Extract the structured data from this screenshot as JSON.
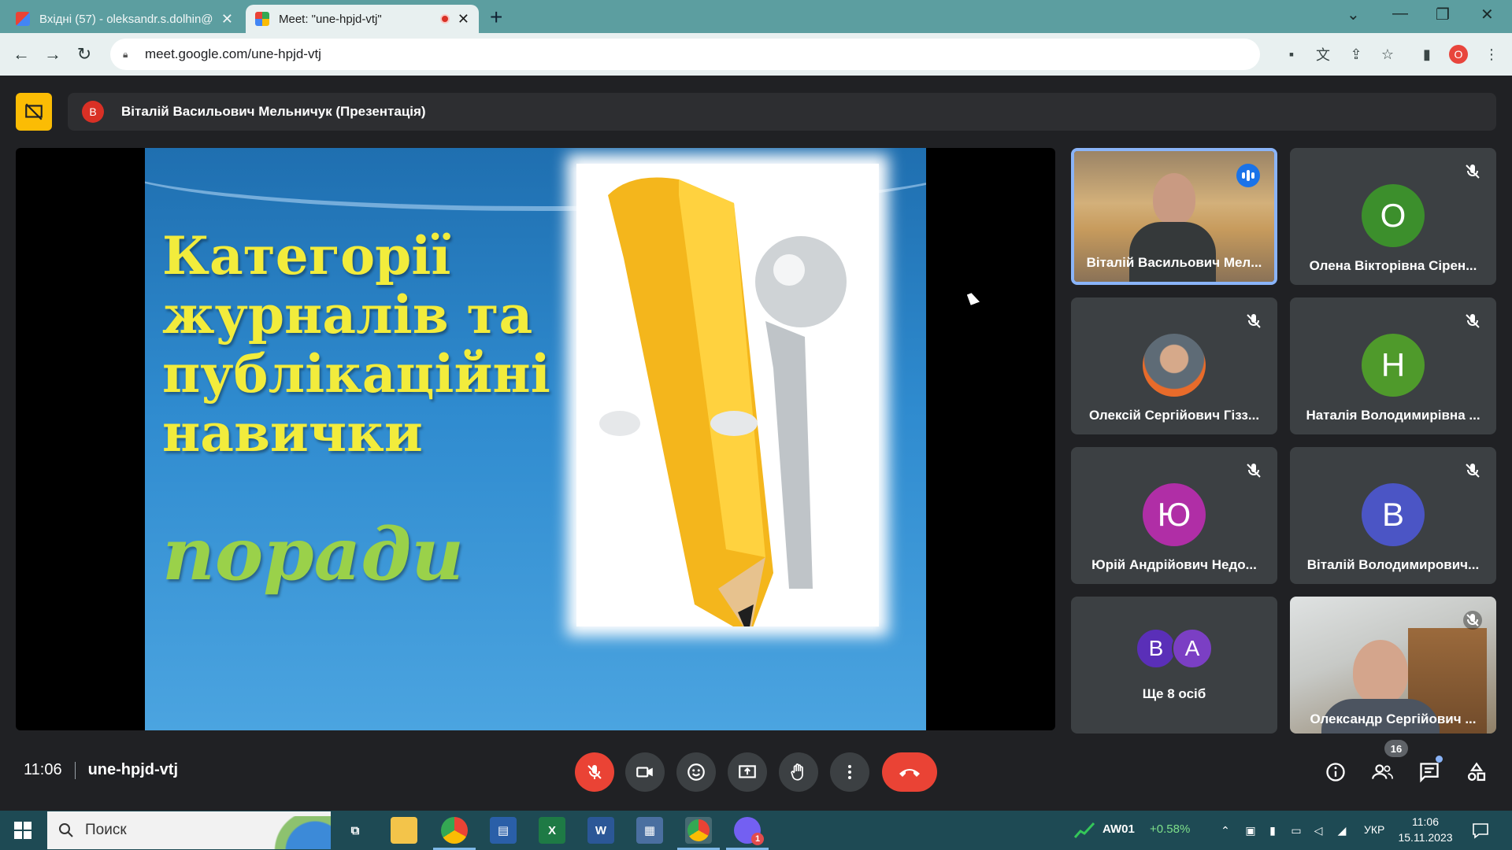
{
  "browser": {
    "tabs": [
      {
        "title": "Вхідні (57) - oleksandr.s.dolhin@",
        "favicon": "gmail-icon",
        "active": false
      },
      {
        "title": "Meet: \"une-hpjd-vtj\"",
        "favicon": "meet-icon",
        "active": true,
        "recording": true
      }
    ],
    "url": "meet.google.com/une-hpjd-vtj",
    "profile_initial": "O"
  },
  "presenting": {
    "avatar_initial": "В",
    "label": "Віталій Васильович Мельничук (Презентація)"
  },
  "slide": {
    "title_lines": [
      "Категорії",
      "журналів та",
      "публікаційні",
      "навички"
    ],
    "subtitle": "поради"
  },
  "participants": [
    {
      "name": "Віталій Васильович Мел...",
      "type": "video",
      "speaking": true
    },
    {
      "name": "Олена Вікторівна Сірен...",
      "initial": "О",
      "color": "#3c8f2c",
      "muted": true
    },
    {
      "name": "Олексій Сергійович Гізз...",
      "type": "photo",
      "muted": true
    },
    {
      "name": "Наталія Володимирівна ...",
      "initial": "Н",
      "color": "#4f9a2b",
      "muted": true
    },
    {
      "name": "Юрій Андрійович Недо...",
      "initial": "Ю",
      "color": "#b02ea6",
      "muted": true
    },
    {
      "name": "Віталій Володимирович...",
      "initial": "В",
      "color": "#4b55c5",
      "muted": true
    },
    {
      "name": "Ще 8 осіб",
      "type": "more",
      "initials": [
        "В",
        "А"
      ],
      "colors": [
        "#5a2fb8",
        "#7b3fc4"
      ]
    },
    {
      "name": "Олександр Сергійович ...",
      "type": "video",
      "muted": true
    }
  ],
  "meeting": {
    "time": "11:06",
    "code": "une-hpjd-vtj",
    "participant_count": "16"
  },
  "taskbar": {
    "search_placeholder": "Поиск",
    "stock_symbol": "AW01",
    "stock_change": "+0.58%",
    "lang": "УКР",
    "clock_time": "11:06",
    "clock_date": "15.11.2023",
    "viber_badge": "1"
  },
  "colors": {
    "accent_red": "#ea4335",
    "speaker_border": "#8ab4f8",
    "stage_bg": "#202124"
  }
}
